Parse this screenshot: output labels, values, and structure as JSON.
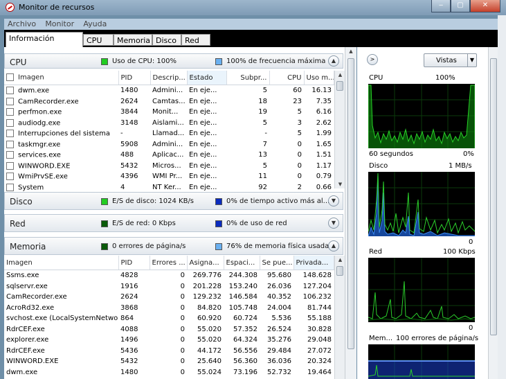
{
  "window": {
    "title": "Monitor de recursos",
    "controls": [
      "‒",
      "▢",
      "✕"
    ]
  },
  "menu": [
    "Archivo",
    "Monitor",
    "Ayuda"
  ],
  "tabs": [
    "Información general",
    "CPU",
    "Memoria",
    "Disco",
    "Red"
  ],
  "colors": {
    "green": "#22cc22",
    "blue": "#6ab0f0",
    "darkgreen": "#0a5a0a",
    "darkblue": "#0a2bbf",
    "graph_bg": "#000000",
    "graph_line": "#20c020"
  },
  "cpu": {
    "name": "CPU",
    "stat1": "Uso de CPU: 100%",
    "stat2": "100% de frecuencia máxima",
    "columns": [
      "Imagen",
      "PID",
      "Descrip...",
      "Estado",
      "Subpr...",
      "CPU",
      "Uso m..."
    ],
    "rows": [
      [
        "dwm.exe",
        "1480",
        "Admini...",
        "En eje...",
        "5",
        "60",
        "16.13"
      ],
      [
        "CamRecorder.exe",
        "2624",
        "Camtas...",
        "En eje...",
        "18",
        "23",
        "7.35"
      ],
      [
        "perfmon.exe",
        "3844",
        "Monit...",
        "En eje...",
        "19",
        "5",
        "6.16"
      ],
      [
        "audiodg.exe",
        "3148",
        "Aislami...",
        "En eje...",
        "5",
        "3",
        "2.62"
      ],
      [
        "Interrupciones del sistema",
        "-",
        "Llamad...",
        "En eje...",
        "-",
        "5",
        "1.99"
      ],
      [
        "taskmgr.exe",
        "5908",
        "Admini...",
        "En eje...",
        "7",
        "0",
        "1.65"
      ],
      [
        "services.exe",
        "488",
        "Aplicac...",
        "En eje...",
        "13",
        "0",
        "1.51"
      ],
      [
        "WINWORD.EXE",
        "5432",
        "Micros...",
        "En eje...",
        "5",
        "0",
        "1.17"
      ],
      [
        "WmiPrvSE.exe",
        "4396",
        "WMI Pr...",
        "En eje...",
        "11",
        "0",
        "0.79"
      ],
      [
        "System",
        "4",
        "NT Ker...",
        "En eje...",
        "92",
        "2",
        "0.66"
      ]
    ]
  },
  "disk": {
    "name": "Disco",
    "stat1": "E/S de disco: 1024 KB/s",
    "stat2": "0% de tiempo activo más al..."
  },
  "net": {
    "name": "Red",
    "stat1": "E/S de red: 0 Kbps",
    "stat2": "0% de uso de red"
  },
  "memory": {
    "name": "Memoria",
    "stat1": "0 errores de página/s",
    "stat2": "76% de memoria física usada",
    "columns": [
      "Imagen",
      "PID",
      "Errores ...",
      "Asigna...",
      "Espaci...",
      "Se pue...",
      "Privada..."
    ],
    "rows": [
      [
        "Ssms.exe",
        "4828",
        "0",
        "269.776",
        "244.308",
        "95.680",
        "148.628"
      ],
      [
        "sqlservr.exe",
        "1916",
        "0",
        "201.228",
        "153.240",
        "26.036",
        "127.204"
      ],
      [
        "CamRecorder.exe",
        "2624",
        "0",
        "129.232",
        "146.584",
        "40.352",
        "106.232"
      ],
      [
        "AcroRd32.exe",
        "3868",
        "0",
        "84.820",
        "105.748",
        "24.004",
        "81.744"
      ],
      [
        "svchost.exe (LocalSystemNetwo...",
        "864",
        "0",
        "60.920",
        "60.724",
        "5.536",
        "55.188"
      ],
      [
        "RdrCEF.exe",
        "4088",
        "0",
        "55.020",
        "57.352",
        "26.524",
        "30.828"
      ],
      [
        "explorer.exe",
        "1496",
        "0",
        "55.020",
        "64.324",
        "35.276",
        "29.048"
      ],
      [
        "RdrCEF.exe",
        "5436",
        "0",
        "44.172",
        "56.556",
        "29.484",
        "27.072"
      ],
      [
        "WINWORD.EXE",
        "5432",
        "0",
        "25.640",
        "56.360",
        "36.036",
        "20.324"
      ],
      [
        "dwm.exe",
        "1480",
        "0",
        "55.024",
        "73.196",
        "52.732",
        "19.464"
      ]
    ]
  },
  "right": {
    "views_label": "Vistas",
    "graphs": [
      {
        "name": "CPU",
        "max": "100%",
        "footer_left": "60 segundos",
        "footer_right": "0%"
      },
      {
        "name": "Disco",
        "max": "1 MB/s",
        "footer_left": "",
        "footer_right": "0"
      },
      {
        "name": "Red",
        "max": "100 Kbps",
        "footer_left": "",
        "footer_right": "0"
      },
      {
        "name": "Mem...",
        "max": "100 errores de página/s",
        "footer_left": "",
        "footer_right": ""
      }
    ]
  }
}
